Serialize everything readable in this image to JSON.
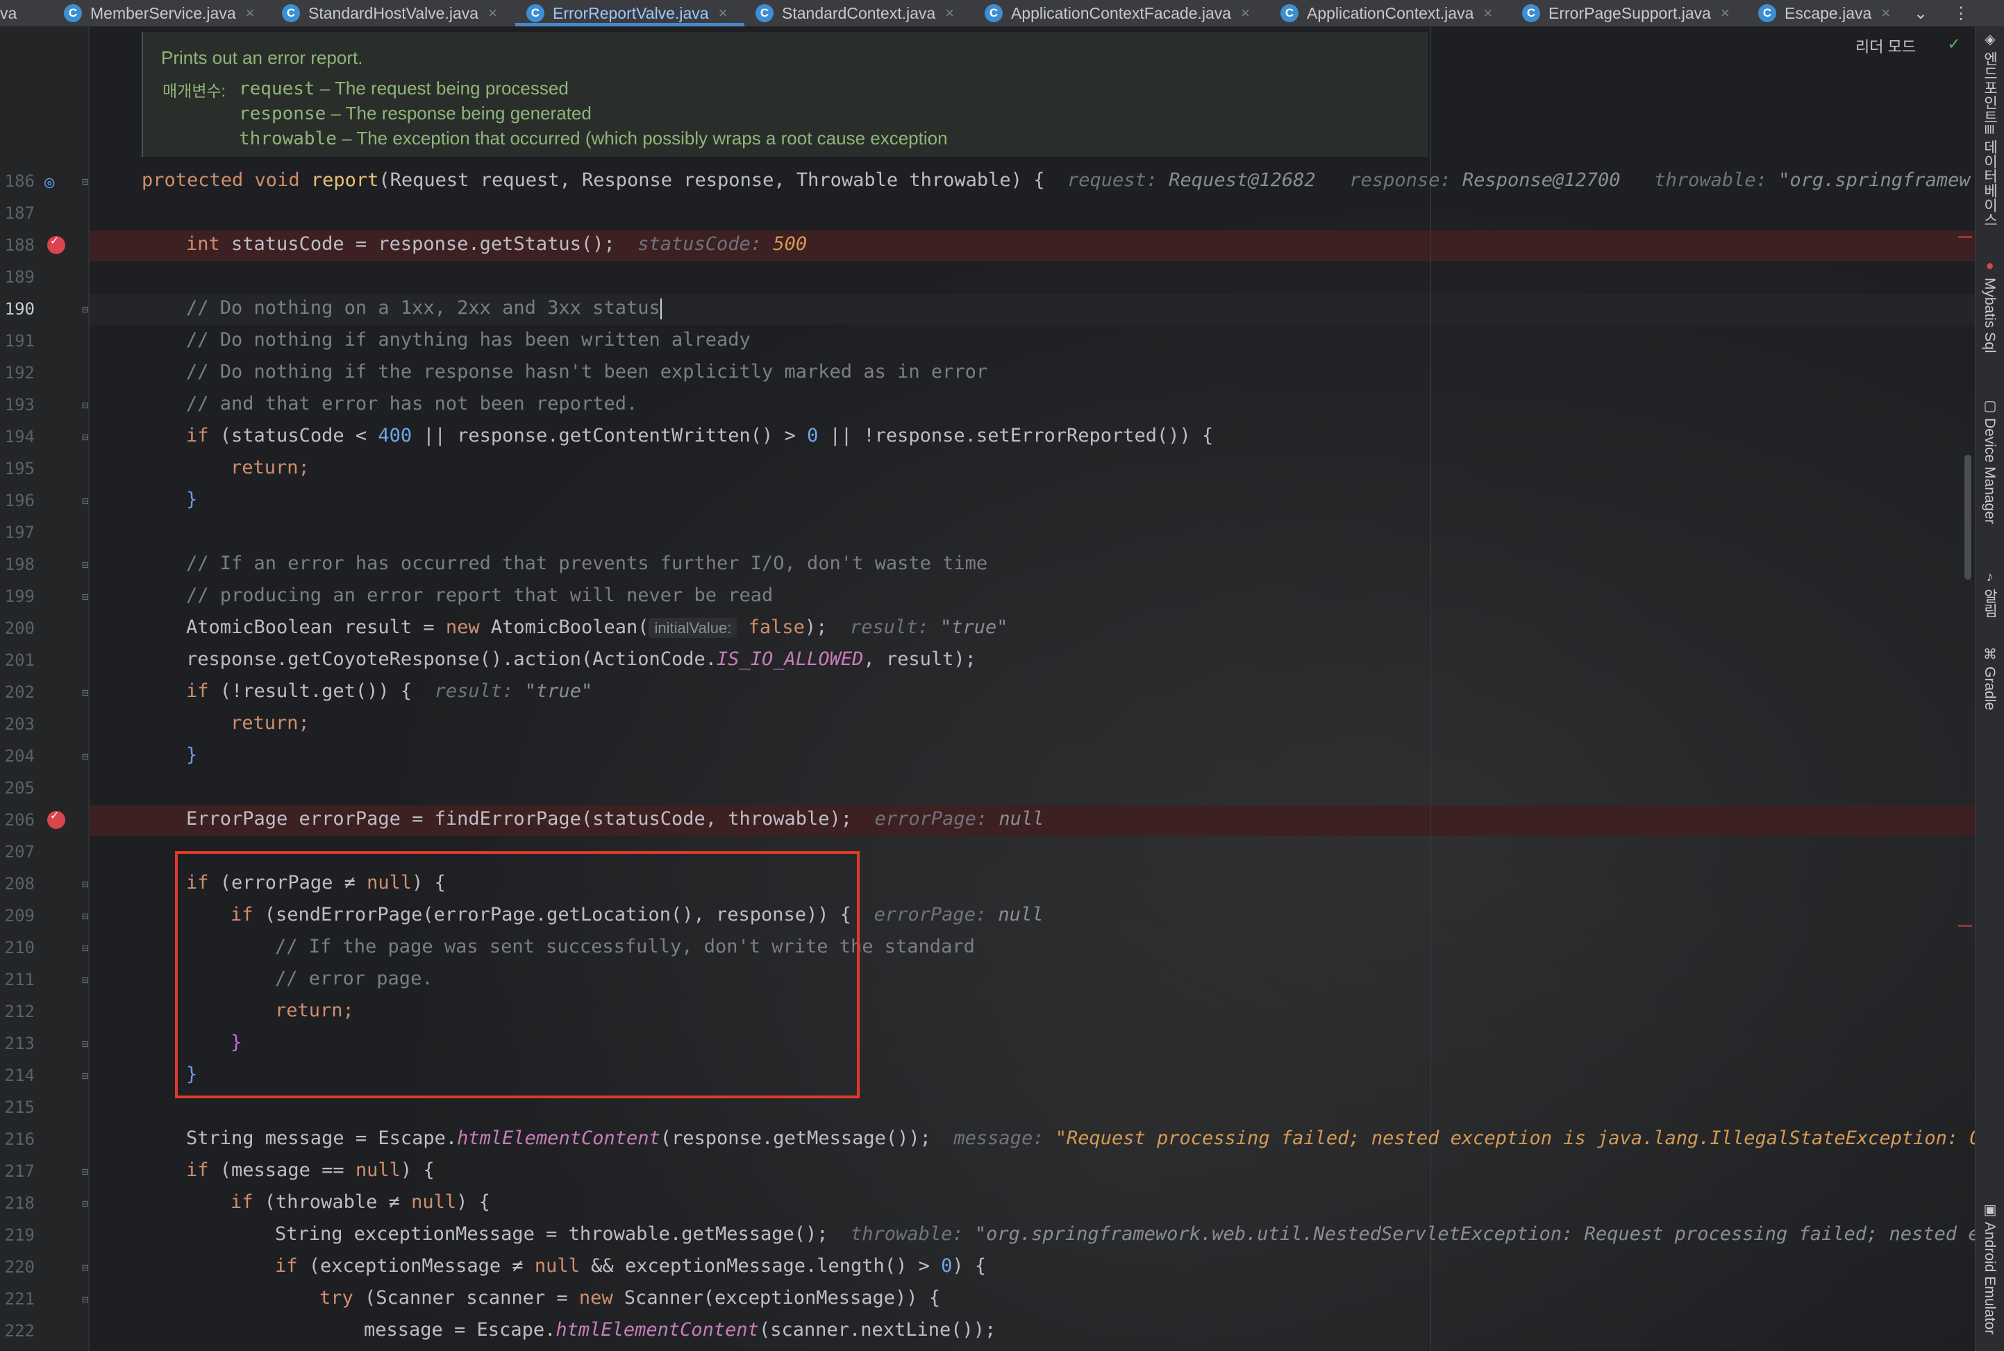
{
  "tabs": [
    {
      "label": "va",
      "has_icon": false
    },
    {
      "label": "MemberService.java",
      "has_icon": true
    },
    {
      "label": "StandardHostValve.java",
      "has_icon": true
    },
    {
      "label": "ErrorReportValve.java",
      "has_icon": true,
      "active": true
    },
    {
      "label": "StandardContext.java",
      "has_icon": true
    },
    {
      "label": "ApplicationContextFacade.java",
      "has_icon": true
    },
    {
      "label": "ApplicationContext.java",
      "has_icon": true
    },
    {
      "label": "ErrorPageSupport.java",
      "has_icon": true
    },
    {
      "label": "Escape.java",
      "has_icon": true
    }
  ],
  "tab_icon_letter": "C",
  "close_glyph": "×",
  "tab_more_glyph": "⌄",
  "kebab_glyph": "⋮",
  "reader_mode": "리더 모드",
  "right_tools": [
    "엔드포인트",
    "데이터베이스",
    "Mybatis Sql",
    "Device Manager",
    "알림",
    "Gradle",
    "Android Emulator"
  ],
  "doc": {
    "summary": "Prints out an error report.",
    "params_label": "매개변수:",
    "params": [
      {
        "name": "request",
        "desc": " – The request being processed"
      },
      {
        "name": "response",
        "desc": " – The response being generated"
      },
      {
        "name": "throwable",
        "desc": " – The exception that occurred (which possibly wraps a root cause exception"
      }
    ]
  },
  "line_numbers": [
    "186",
    "187",
    "188",
    "189",
    "190",
    "191",
    "192",
    "193",
    "194",
    "195",
    "196",
    "197",
    "198",
    "199",
    "200",
    "201",
    "202",
    "203",
    "204",
    "205",
    "206",
    "207",
    "208",
    "209",
    "210",
    "211",
    "212",
    "213",
    "214",
    "215",
    "216",
    "217",
    "218",
    "219",
    "220",
    "221",
    "222"
  ],
  "current_line": "190",
  "breakpoint_lines": [
    "188",
    "206"
  ],
  "code": {
    "l186": {
      "a": "protected void ",
      "fn": "report",
      "b": "(Request request, Response response, Throwable throwable) {",
      "h1l": "request: ",
      "h1v": "Request@12682",
      "h2l": "response: ",
      "h2v": "Response@12700",
      "h3l": "throwable: ",
      "h3v": "\"org.springframew"
    },
    "l188": {
      "a": "int ",
      "b": "statusCode = response.getStatus();",
      "hl": "statusCode: ",
      "hv": "500"
    },
    "l190": {
      "text": "// Do nothing on a 1xx, 2xx and 3xx status"
    },
    "l191": {
      "text": "// Do nothing if anything has been written already"
    },
    "l192": {
      "text": "// Do nothing if the response hasn't been explicitly marked as in error"
    },
    "l193": {
      "text": "// and that error has not been reported."
    },
    "l194": {
      "a": "if ",
      "b": "(statusCode < ",
      "n1": "400",
      "c": " || response.getContentWritten() > ",
      "n2": "0",
      "d": " || !response.setErrorReported()) {"
    },
    "l195": {
      "text": "return;"
    },
    "l196": {
      "text": "}"
    },
    "l198": {
      "text": "// If an error has occurred that prevents further I/O, don't waste time"
    },
    "l199": {
      "text": "// producing an error report that will never be read"
    },
    "l200": {
      "a": "AtomicBoolean result = ",
      "kw": "new ",
      "b": "AtomicBoolean(",
      "param": "initialValue:",
      "c": " false",
      "d": ");",
      "hl": "result: ",
      "hv": "\"true\""
    },
    "l201": {
      "a": "response.getCoyoteResponse().action(ActionCode.",
      "it": "IS_IO_ALLOWED",
      "b": ", result);"
    },
    "l202": {
      "a": "if ",
      "b": "(!result.get()) {",
      "hl": "result: ",
      "hv": "\"true\""
    },
    "l203": {
      "text": "return;"
    },
    "l204": {
      "text": "}"
    },
    "l206": {
      "a": "ErrorPage errorPage = findErrorPage(statusCode, throwable);",
      "hl": "errorPage: ",
      "hv": "null"
    },
    "l208": {
      "a": "if ",
      "b": "(errorPage ≠ ",
      "c": "null",
      "d": ") {"
    },
    "l209": {
      "a": "if ",
      "b": "(sendErrorPage(errorPage.getLocation(), response)) {",
      "hl": "errorPage: ",
      "hv": "null"
    },
    "l210": {
      "text": "// If the page was sent successfully, don't write the standard"
    },
    "l211": {
      "text": "// error page."
    },
    "l212": {
      "text": "return;"
    },
    "l213": {
      "text": "}"
    },
    "l214": {
      "text": "}"
    },
    "l216": {
      "a": "String message = Escape.",
      "it": "htmlElementContent",
      "b": "(response.getMessage());",
      "hl": "message: ",
      "hv": "\"Request processing failed; nested exception is java.lang.IllegalStateException: O|C"
    },
    "l217": {
      "a": "if ",
      "b": "(message == ",
      "c": "null",
      "d": ") {"
    },
    "l218": {
      "a": "if ",
      "b": "(throwable ≠ ",
      "c": "null",
      "d": ") {"
    },
    "l219": {
      "a": "String exceptionMessage = throwable.getMessage();",
      "hl": "throwable: ",
      "hv": "\"org.springframework.web.util.NestedServletException: Request processing failed; nested ex"
    },
    "l220": {
      "a": "if ",
      "b": "(exceptionMessage ≠ ",
      "c": "null",
      "d": " && exceptionMessage.length() > ",
      "n": "0",
      "e": ") {"
    },
    "l221": {
      "a": "try ",
      "b": "(Scanner scanner = ",
      "kw": "new ",
      "c": "Scanner(exceptionMessage)) {"
    },
    "l222": {
      "a": "message = Escape.",
      "it": "htmlElementContent",
      "b": "(scanner.nextLine());"
    }
  },
  "colors": {
    "keyword": "#cf8e6d",
    "method": "#e8c07a",
    "number": "#6da7e8",
    "comment": "#7a7e85",
    "breakpoint": "#d9444d",
    "highlight_box": "#e0392b"
  }
}
